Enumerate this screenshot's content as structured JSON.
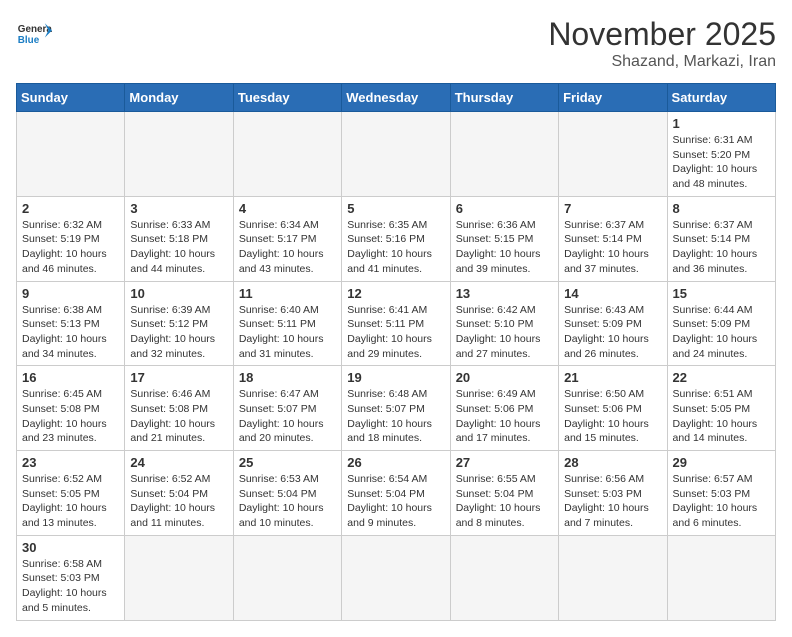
{
  "header": {
    "logo_general": "General",
    "logo_blue": "Blue",
    "month_title": "November 2025",
    "location": "Shazand, Markazi, Iran"
  },
  "weekdays": [
    "Sunday",
    "Monday",
    "Tuesday",
    "Wednesday",
    "Thursday",
    "Friday",
    "Saturday"
  ],
  "weeks": [
    [
      {
        "day": "",
        "info": ""
      },
      {
        "day": "",
        "info": ""
      },
      {
        "day": "",
        "info": ""
      },
      {
        "day": "",
        "info": ""
      },
      {
        "day": "",
        "info": ""
      },
      {
        "day": "",
        "info": ""
      },
      {
        "day": "1",
        "info": "Sunrise: 6:31 AM\nSunset: 5:20 PM\nDaylight: 10 hours and 48 minutes."
      }
    ],
    [
      {
        "day": "2",
        "info": "Sunrise: 6:32 AM\nSunset: 5:19 PM\nDaylight: 10 hours and 46 minutes."
      },
      {
        "day": "3",
        "info": "Sunrise: 6:33 AM\nSunset: 5:18 PM\nDaylight: 10 hours and 44 minutes."
      },
      {
        "day": "4",
        "info": "Sunrise: 6:34 AM\nSunset: 5:17 PM\nDaylight: 10 hours and 43 minutes."
      },
      {
        "day": "5",
        "info": "Sunrise: 6:35 AM\nSunset: 5:16 PM\nDaylight: 10 hours and 41 minutes."
      },
      {
        "day": "6",
        "info": "Sunrise: 6:36 AM\nSunset: 5:15 PM\nDaylight: 10 hours and 39 minutes."
      },
      {
        "day": "7",
        "info": "Sunrise: 6:37 AM\nSunset: 5:14 PM\nDaylight: 10 hours and 37 minutes."
      },
      {
        "day": "8",
        "info": "Sunrise: 6:37 AM\nSunset: 5:14 PM\nDaylight: 10 hours and 36 minutes."
      }
    ],
    [
      {
        "day": "9",
        "info": "Sunrise: 6:38 AM\nSunset: 5:13 PM\nDaylight: 10 hours and 34 minutes."
      },
      {
        "day": "10",
        "info": "Sunrise: 6:39 AM\nSunset: 5:12 PM\nDaylight: 10 hours and 32 minutes."
      },
      {
        "day": "11",
        "info": "Sunrise: 6:40 AM\nSunset: 5:11 PM\nDaylight: 10 hours and 31 minutes."
      },
      {
        "day": "12",
        "info": "Sunrise: 6:41 AM\nSunset: 5:11 PM\nDaylight: 10 hours and 29 minutes."
      },
      {
        "day": "13",
        "info": "Sunrise: 6:42 AM\nSunset: 5:10 PM\nDaylight: 10 hours and 27 minutes."
      },
      {
        "day": "14",
        "info": "Sunrise: 6:43 AM\nSunset: 5:09 PM\nDaylight: 10 hours and 26 minutes."
      },
      {
        "day": "15",
        "info": "Sunrise: 6:44 AM\nSunset: 5:09 PM\nDaylight: 10 hours and 24 minutes."
      }
    ],
    [
      {
        "day": "16",
        "info": "Sunrise: 6:45 AM\nSunset: 5:08 PM\nDaylight: 10 hours and 23 minutes."
      },
      {
        "day": "17",
        "info": "Sunrise: 6:46 AM\nSunset: 5:08 PM\nDaylight: 10 hours and 21 minutes."
      },
      {
        "day": "18",
        "info": "Sunrise: 6:47 AM\nSunset: 5:07 PM\nDaylight: 10 hours and 20 minutes."
      },
      {
        "day": "19",
        "info": "Sunrise: 6:48 AM\nSunset: 5:07 PM\nDaylight: 10 hours and 18 minutes."
      },
      {
        "day": "20",
        "info": "Sunrise: 6:49 AM\nSunset: 5:06 PM\nDaylight: 10 hours and 17 minutes."
      },
      {
        "day": "21",
        "info": "Sunrise: 6:50 AM\nSunset: 5:06 PM\nDaylight: 10 hours and 15 minutes."
      },
      {
        "day": "22",
        "info": "Sunrise: 6:51 AM\nSunset: 5:05 PM\nDaylight: 10 hours and 14 minutes."
      }
    ],
    [
      {
        "day": "23",
        "info": "Sunrise: 6:52 AM\nSunset: 5:05 PM\nDaylight: 10 hours and 13 minutes."
      },
      {
        "day": "24",
        "info": "Sunrise: 6:52 AM\nSunset: 5:04 PM\nDaylight: 10 hours and 11 minutes."
      },
      {
        "day": "25",
        "info": "Sunrise: 6:53 AM\nSunset: 5:04 PM\nDaylight: 10 hours and 10 minutes."
      },
      {
        "day": "26",
        "info": "Sunrise: 6:54 AM\nSunset: 5:04 PM\nDaylight: 10 hours and 9 minutes."
      },
      {
        "day": "27",
        "info": "Sunrise: 6:55 AM\nSunset: 5:04 PM\nDaylight: 10 hours and 8 minutes."
      },
      {
        "day": "28",
        "info": "Sunrise: 6:56 AM\nSunset: 5:03 PM\nDaylight: 10 hours and 7 minutes."
      },
      {
        "day": "29",
        "info": "Sunrise: 6:57 AM\nSunset: 5:03 PM\nDaylight: 10 hours and 6 minutes."
      }
    ],
    [
      {
        "day": "30",
        "info": "Sunrise: 6:58 AM\nSunset: 5:03 PM\nDaylight: 10 hours and 5 minutes."
      },
      {
        "day": "",
        "info": ""
      },
      {
        "day": "",
        "info": ""
      },
      {
        "day": "",
        "info": ""
      },
      {
        "day": "",
        "info": ""
      },
      {
        "day": "",
        "info": ""
      },
      {
        "day": "",
        "info": ""
      }
    ]
  ]
}
